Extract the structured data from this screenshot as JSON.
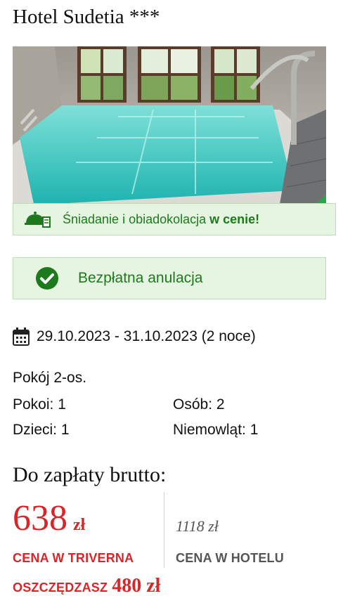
{
  "hotel": {
    "name": "Hotel Sudetia ***"
  },
  "meal_banner": {
    "text": "Śniadanie i obiadokolacja ",
    "bold": "w cenie!",
    "icon": "meal-tray-icon"
  },
  "cancellation": {
    "label": "Bezpłatna anulacja",
    "icon": "check-circle-icon"
  },
  "stay": {
    "dates": "29.10.2023 - 31.10.2023 (2 noce)",
    "icon": "calendar-icon"
  },
  "room": {
    "type": "Pokój 2-os.",
    "rooms": "Pokoi: 1",
    "persons": "Osób: 2",
    "children": "Dzieci: 1",
    "infants": "Niemowląt: 1"
  },
  "payment": {
    "title": "Do zapłaty brutto:",
    "price": "638",
    "currency": "zł",
    "price_label": "CENA W TRIVERNA",
    "hotel_price": "1118 zł",
    "hotel_price_label": "CENA W HOTELU",
    "savings_label": "OSZCZĘDZASZ",
    "savings_amount": "480 zł"
  },
  "colors": {
    "accent_red": "#d6262a",
    "success_green": "#1c7a1c",
    "success_bg": "#e6f5e1"
  }
}
